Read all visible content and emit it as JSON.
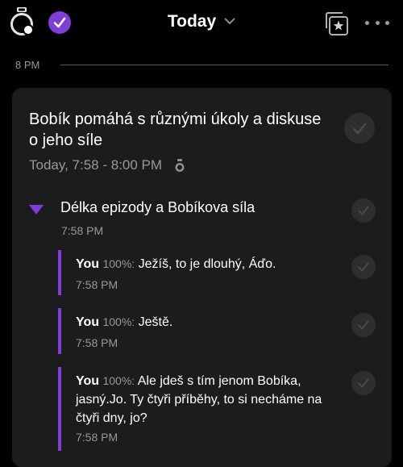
{
  "header": {
    "title": "Today",
    "icons": [
      "watch-icon",
      "check-icon",
      "chevron-down-icon",
      "star-stack-icon",
      "more-icon"
    ]
  },
  "timeline": {
    "label": "8 PM"
  },
  "event": {
    "title": "Bobík pomáhá s různými úkoly a diskuse o jeho síle",
    "subtitle": "Today, 7:58 - 8:00 PM",
    "section": {
      "title": "Délka epizody a Bobíkova síla",
      "time": "7:58 PM"
    },
    "entries": [
      {
        "speaker": "You",
        "confidence": "100%:",
        "text": "Ježíš, to je dlouhý, Áďo.",
        "time": "7:58 PM"
      },
      {
        "speaker": "You",
        "confidence": "100%:",
        "text": "Ještě.",
        "time": "7:58 PM"
      },
      {
        "speaker": "You",
        "confidence": "100%:",
        "text": "Ale jdeš s tím jenom Bobíka, jasný.Jo. Ty čtyři příběhy, to si necháme na čtyři dny, jo?",
        "time": "7:58 PM"
      }
    ]
  },
  "colors": {
    "accent": "#7f3ed6",
    "background": "#000000",
    "card": "#1c1c1e",
    "muted": "#98989d"
  }
}
